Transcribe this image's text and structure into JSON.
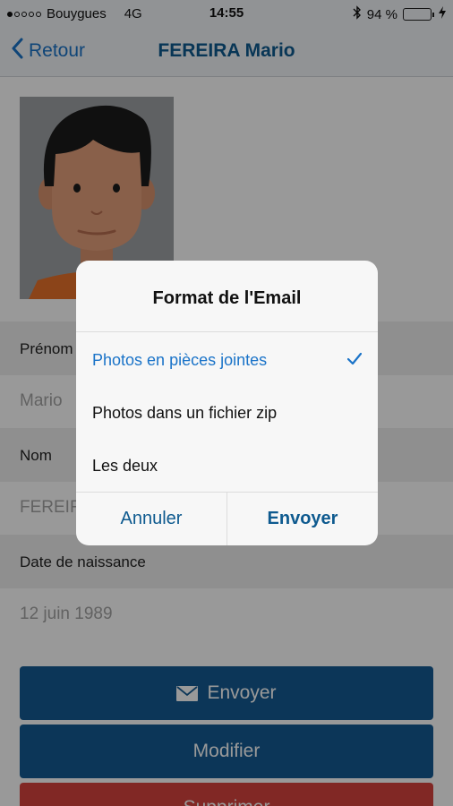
{
  "status": {
    "carrier": "Bouygues",
    "network": "4G",
    "time": "14:55",
    "battery": "94 %",
    "battery_level": 0.94,
    "signal_bars_filled": 1,
    "signal_bars_total": 5
  },
  "nav": {
    "back_label": "Retour",
    "title": "FEREIRA Mario"
  },
  "fields": [
    {
      "label": "Prénom",
      "value": "Mario"
    },
    {
      "label": "Nom",
      "value": "FEREIRA"
    },
    {
      "label": "Date de naissance",
      "value": "12 juin 1989"
    }
  ],
  "buttons": {
    "send": "Envoyer",
    "edit": "Modifier",
    "delete": "Supprimer"
  },
  "dialog": {
    "title": "Format de l'Email",
    "options": [
      {
        "label": "Photos en pièces jointes",
        "selected": true
      },
      {
        "label": "Photos dans un fichier zip",
        "selected": false
      },
      {
        "label": "Les deux",
        "selected": false
      }
    ],
    "cancel": "Annuler",
    "confirm": "Envoyer"
  },
  "colors": {
    "primary": "#155b93",
    "danger": "#d8433f",
    "link": "#1a73c8"
  },
  "icons": [
    "back-chevron-icon",
    "bluetooth-icon",
    "battery-icon",
    "charging-icon",
    "mail-icon",
    "checkmark-icon"
  ]
}
